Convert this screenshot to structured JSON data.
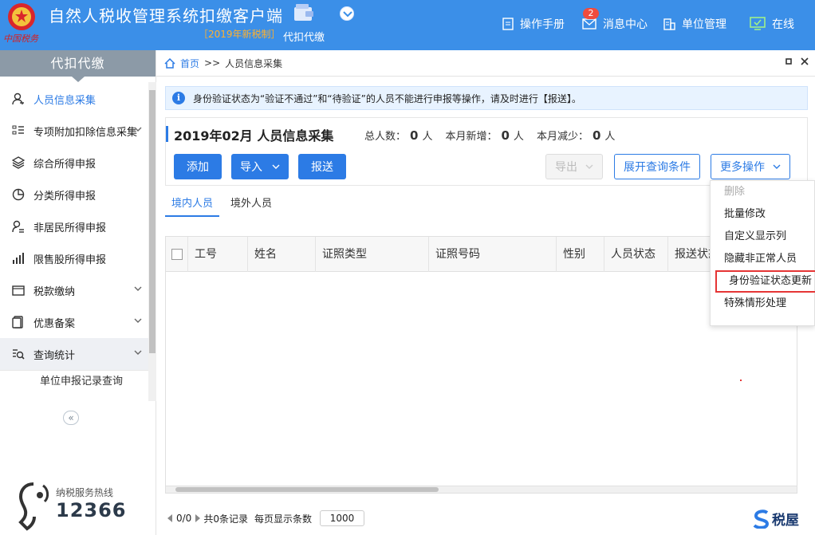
{
  "header": {
    "app_title": "自然人税收管理系统扣缴客户端",
    "edition": "［2019年新税制］",
    "signature_text": "中国税务",
    "module": "代扣代缴",
    "nav": {
      "manual": "操作手册",
      "messages": "消息中心",
      "message_count": "2",
      "unit": "单位管理",
      "online": "在线"
    }
  },
  "sidebar": {
    "title": "代扣代缴",
    "items": [
      {
        "label": "人员信息采集",
        "icon": "person-icon"
      },
      {
        "label": "专项附加扣除信息采集",
        "icon": "list-icon"
      },
      {
        "label": "综合所得申报",
        "icon": "layers-icon"
      },
      {
        "label": "分类所得申报",
        "icon": "pie-icon"
      },
      {
        "label": "非居民所得申报",
        "icon": "person-globe-icon"
      },
      {
        "label": "限售股所得申报",
        "icon": "bar-chart-icon"
      },
      {
        "label": "税款缴纳",
        "icon": "wallet-icon"
      },
      {
        "label": "优惠备案",
        "icon": "document-icon"
      },
      {
        "label": "查询统计",
        "icon": "search-list-icon"
      }
    ],
    "sub_items": [
      "单位申报记录查询"
    ],
    "collapse_symbol": "«",
    "hotline_label": "纳税服务热线",
    "hotline_number": "12366"
  },
  "breadcrumb": {
    "home": "首页",
    "separator": ">>",
    "current": "人员信息采集"
  },
  "notice": "身份验证状态为“验证不通过”和“待验证”的人员不能进行申报等操作，请及时进行【报送】。",
  "panel": {
    "title": "2019年02月  人员信息采集",
    "total_label": "总人数：",
    "total": "0",
    "total_unit": "人",
    "new_label": "本月新增：",
    "new": "0",
    "new_unit": "人",
    "less_label": "本月减少：",
    "less": "0",
    "less_unit": "人"
  },
  "toolbar": {
    "add": "添加",
    "import": "导入",
    "submit": "报送",
    "export": "导出",
    "expand_query": "展开查询条件",
    "more": "更多操作"
  },
  "tabs": [
    "境内人员",
    "境外人员"
  ],
  "table": {
    "columns": [
      "工号",
      "姓名",
      "证照类型",
      "证照号码",
      "性别",
      "人员状态",
      "报送状态"
    ]
  },
  "more_menu": [
    "删除",
    "批量修改",
    "自定义显示列",
    "隐藏非正常人员",
    "身份验证状态更新",
    "特殊情形处理"
  ],
  "pager": {
    "page": "0/0",
    "records": "共0条记录",
    "per_page_label": "每页显示条数",
    "per_page": "1000"
  },
  "watermark": "税屋",
  "colors": {
    "primary": "#2c7be5",
    "header": "#3b8fe8",
    "highlight": "#e53535"
  }
}
